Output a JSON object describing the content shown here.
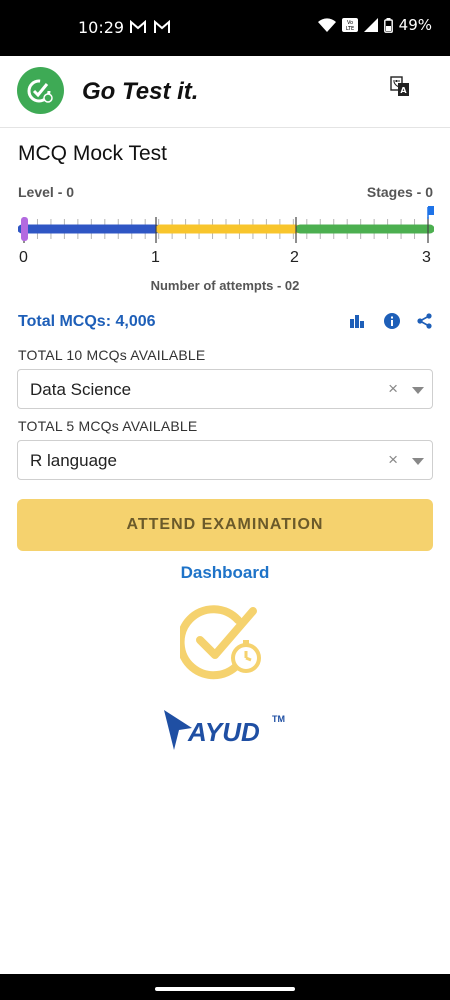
{
  "status_bar": {
    "time": "10:29",
    "battery": "49%",
    "volte_label": "Vo\nLTE"
  },
  "header": {
    "brand": "Go Test it.",
    "logo_icon": "check-clock-icon",
    "translate_icon": "translate-icon"
  },
  "page": {
    "title": "MCQ Mock Test",
    "level": "Level - 0",
    "stages": "Stages - 0"
  },
  "progress": {
    "ticks": [
      "0",
      "1",
      "2",
      "3"
    ],
    "attempts_label": "Number of attempts - 02",
    "current_level": 0,
    "segment_colors": [
      "#2f56c4",
      "#f8c52c",
      "#4caf50"
    ],
    "thumb_color": "#b36ae0",
    "flag_color": "#1e73e8"
  },
  "mcq": {
    "total": "Total MCQs: 4,006",
    "icons": [
      "bar-chart-icon",
      "info-icon",
      "share-icon"
    ],
    "accent": "#1e5fb8"
  },
  "subject": {
    "label": "TOTAL 10 MCQs AVAILABLE",
    "value": "Data Science",
    "clear": "×"
  },
  "topic": {
    "label": "TOTAL 5 MCQs AVAILABLE",
    "value": "R language",
    "clear": "×"
  },
  "actions": {
    "attend": "ATTEND EXAMINATION",
    "dashboard": "Dashboard"
  },
  "footer": {
    "brand": "AYUD",
    "trademark": "TM"
  }
}
